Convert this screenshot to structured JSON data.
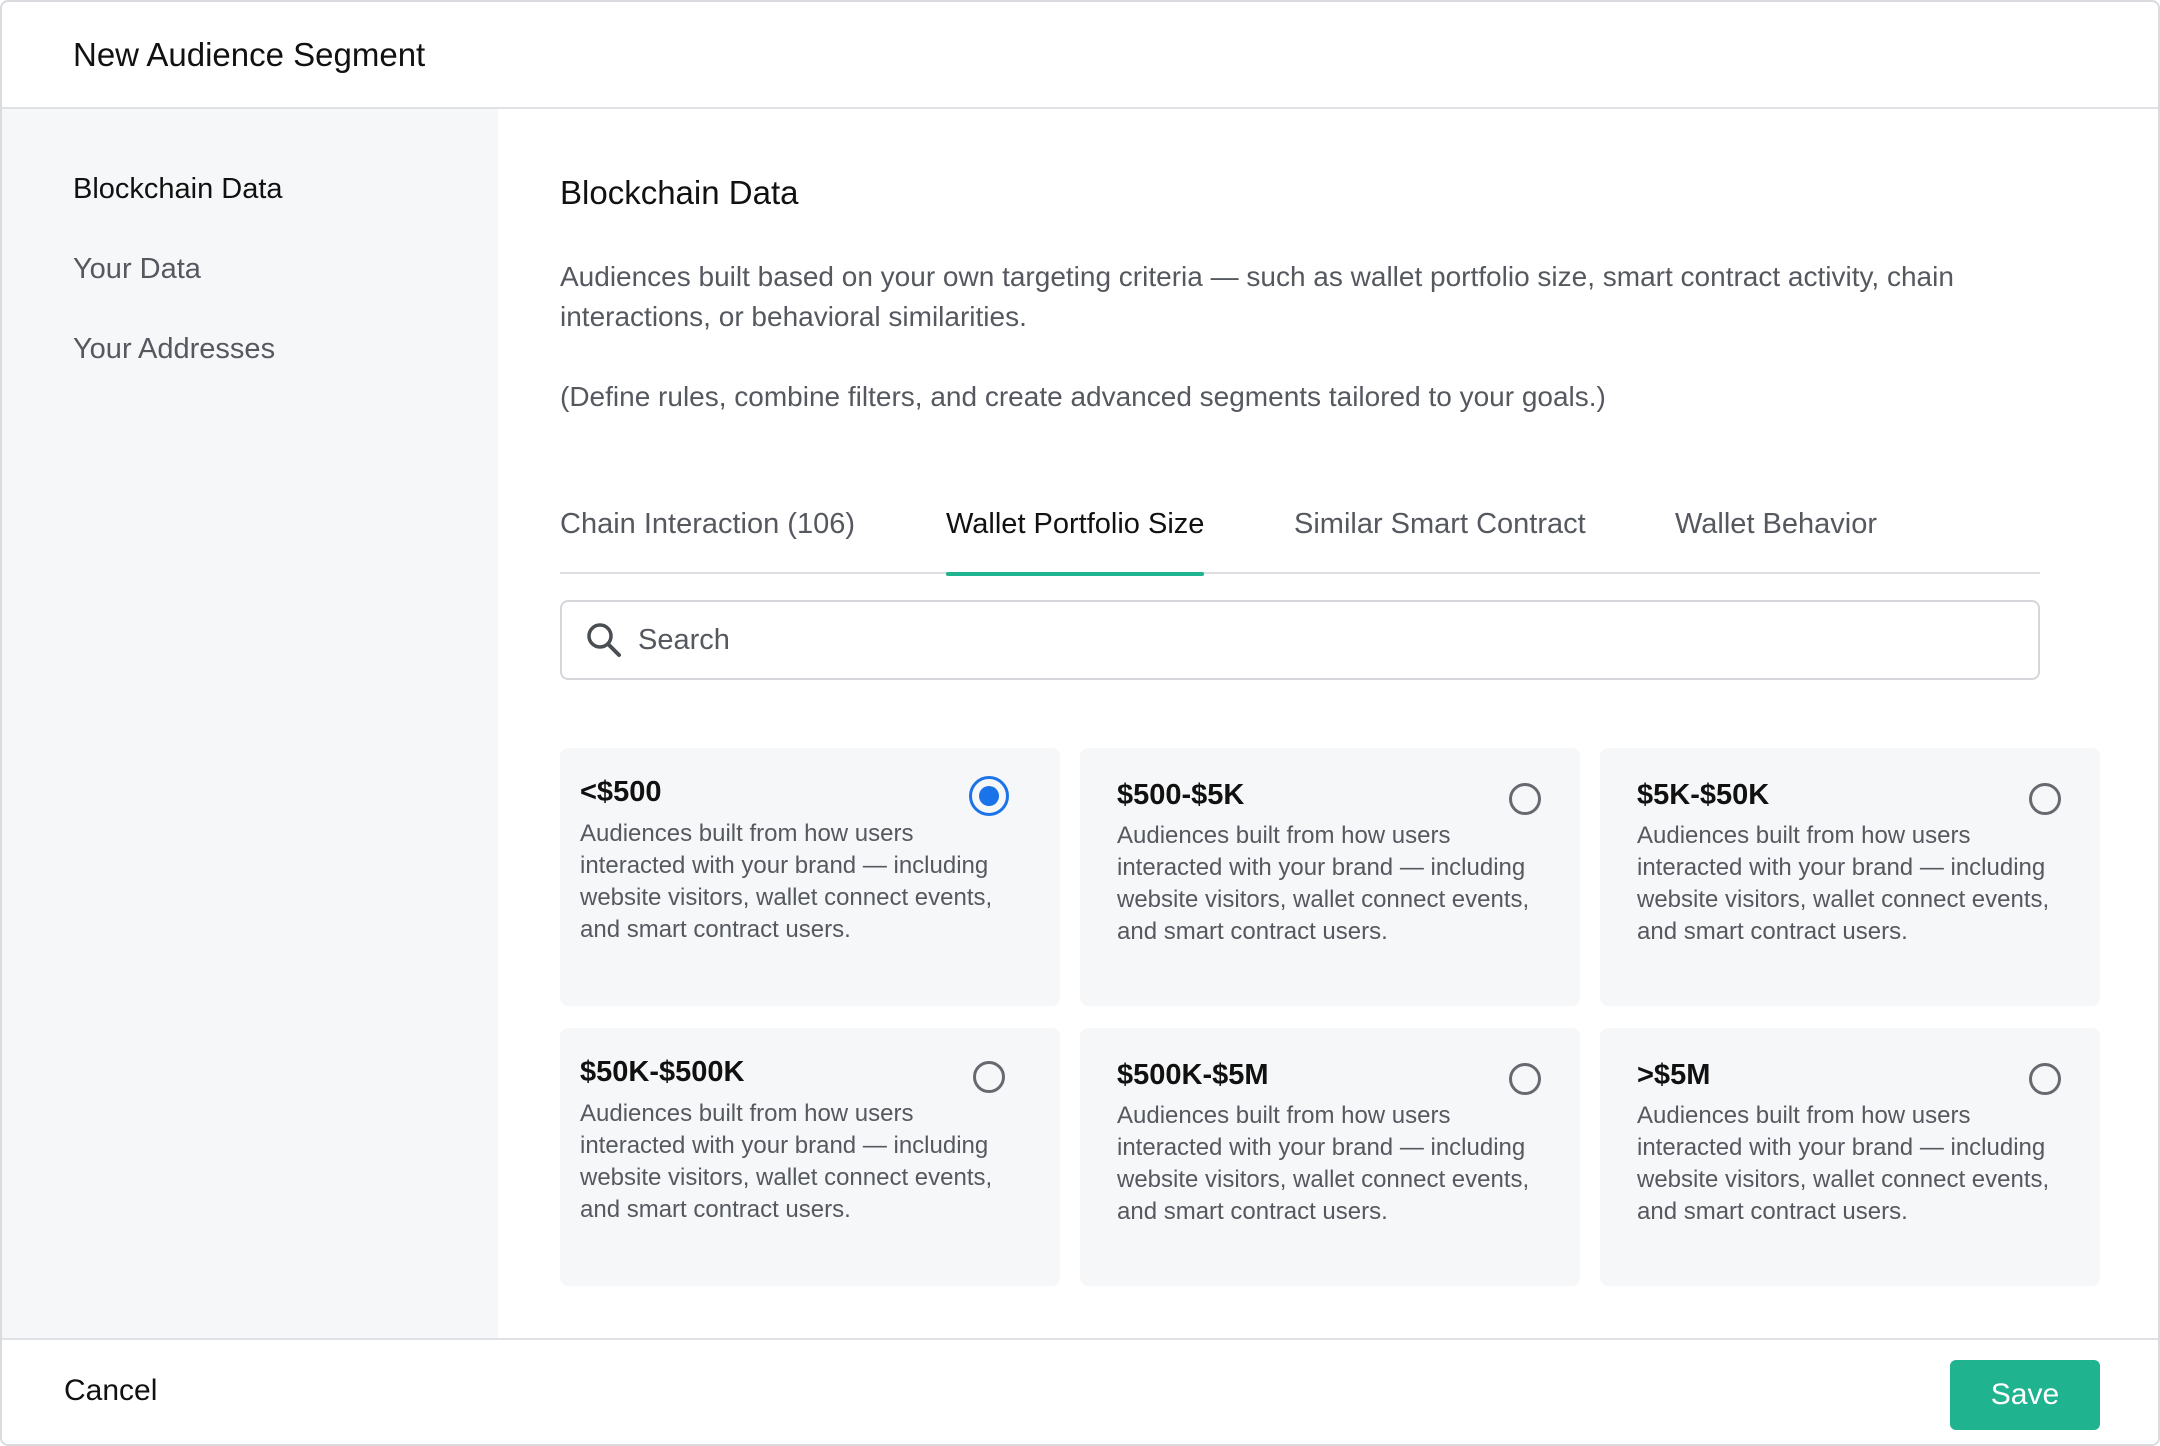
{
  "header": {
    "title": "New Audience Segment"
  },
  "sidebar": {
    "items": [
      {
        "label": "Blockchain Data",
        "active": true
      },
      {
        "label": "Your Data",
        "active": false
      },
      {
        "label": "Your Addresses",
        "active": false
      }
    ]
  },
  "main": {
    "title": "Blockchain Data",
    "description": "Audiences built based on your own targeting criteria — such as wallet portfolio size, smart contract activity, chain interactions, or behavioral similarities.",
    "description_note": "(Define rules, combine filters, and create advanced segments tailored to your goals.)",
    "tabs": [
      {
        "label": "Chain Interaction (106)",
        "active": false
      },
      {
        "label": "Wallet Portfolio Size",
        "active": true
      },
      {
        "label": "Similar Smart Contract",
        "active": false
      },
      {
        "label": "Wallet Behavior",
        "active": false
      }
    ],
    "search": {
      "placeholder": "Search",
      "value": ""
    },
    "options": [
      {
        "title": "<$500",
        "description": "Audiences built from how users interacted with your brand — including website visitors, wallet connect events, and smart contract users.",
        "selected": true
      },
      {
        "title": "$500-$5K",
        "description": "Audiences built from how users interacted with your brand — including website visitors, wallet connect events, and smart contract users.",
        "selected": false
      },
      {
        "title": "$5K-$50K",
        "description": "Audiences built from how users interacted with your brand — including website visitors, wallet connect events, and smart contract users.",
        "selected": false
      },
      {
        "title": "$50K-$500K",
        "description": "Audiences built from how users interacted with your brand — including website visitors, wallet connect events, and smart contract users.",
        "selected": false
      },
      {
        "title": "$500K-$5M",
        "description": "Audiences built from how users interacted with your brand — including website visitors, wallet connect events, and smart contract users.",
        "selected": false
      },
      {
        "title": ">$5M",
        "description": "Audiences built from how users interacted with your brand — including website visitors, wallet connect events, and smart contract users.",
        "selected": false
      }
    ]
  },
  "footer": {
    "cancel_label": "Cancel",
    "save_label": "Save"
  },
  "colors": {
    "accent": "#1fb38f",
    "radio_selected": "#1a73e8",
    "sidebar_bg": "#f6f7f8",
    "card_bg": "#f6f7f8"
  },
  "icons": {
    "search": "search-icon"
  }
}
